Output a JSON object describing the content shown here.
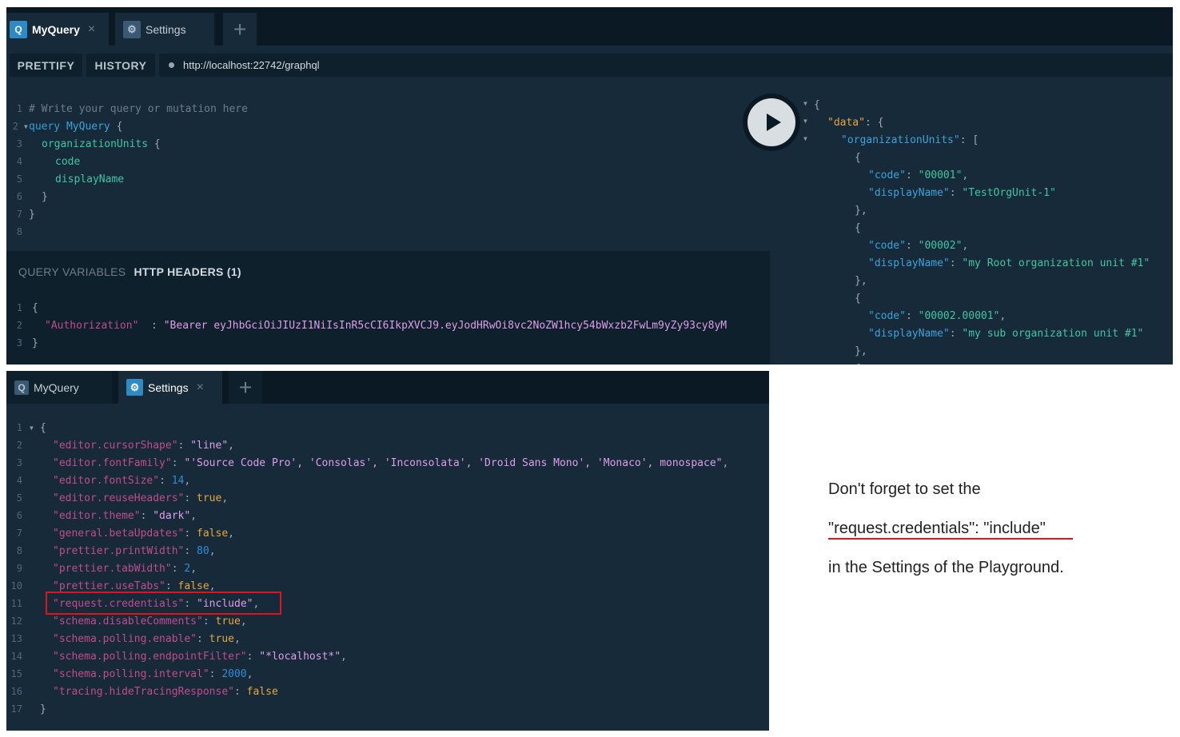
{
  "colors": {
    "accent": "#2d8ac4",
    "highlight_red": "#e0141c",
    "panel_bg": "#172a3a",
    "tabbar_bg": "#0b1924"
  },
  "top_panel": {
    "tabs": [
      {
        "icon": "Q",
        "label": "MyQuery",
        "close": "×"
      },
      {
        "icon": "⚙",
        "label": "Settings"
      }
    ],
    "add_tab": "+",
    "toolbar": {
      "prettify": "PRETTIFY",
      "history": "HISTORY",
      "url": "http://localhost:22742/graphql"
    },
    "query_lines": [
      {
        "n": "1",
        "text": "# Write your query or mutation here"
      },
      {
        "n": "2",
        "kw": "query",
        "name": "MyQuery",
        "brace": " {"
      },
      {
        "n": "3",
        "field": "organizationUnits",
        "brace": " {"
      },
      {
        "n": "4",
        "field": "code"
      },
      {
        "n": "5",
        "field": "displayName"
      },
      {
        "n": "6",
        "brace": "}"
      },
      {
        "n": "7",
        "brace": "}"
      },
      {
        "n": "8"
      }
    ],
    "vars_tabs": {
      "query_variables": "QUERY VARIABLES",
      "http_headers": "HTTP HEADERS (1)"
    },
    "headers_lines": [
      {
        "n": "1",
        "text": "{"
      },
      {
        "n": "2",
        "key": "\"Authorization\"",
        "sep": "  : ",
        "value": "\"Bearer eyJhbGciOiJIUzI1NiIsInR5cCI6IkpXVCJ9.eyJodHRwOi8vc2NoZW1hcy54bWxzb2FwLm9yZy93cy8yM"
      },
      {
        "n": "3",
        "text": "}"
      }
    ],
    "result_lines": [
      {
        "indent": 0,
        "text": "{"
      },
      {
        "indent": 1,
        "key": "\"data\"",
        "rest": ": {"
      },
      {
        "indent": 2,
        "key": "\"organizationUnits\"",
        "rest": ": ["
      },
      {
        "indent": 3,
        "text": "{"
      },
      {
        "indent": 4,
        "key": "\"code\"",
        "sep": ": ",
        "value": "\"00001\"",
        "end": ","
      },
      {
        "indent": 4,
        "key": "\"displayName\"",
        "sep": ": ",
        "value": "\"TestOrgUnit-1\""
      },
      {
        "indent": 3,
        "text": "},"
      },
      {
        "indent": 3,
        "text": "{"
      },
      {
        "indent": 4,
        "key": "\"code\"",
        "sep": ": ",
        "value": "\"00002\"",
        "end": ","
      },
      {
        "indent": 4,
        "key": "\"displayName\"",
        "sep": ": ",
        "value": "\"my Root organization unit #1\""
      },
      {
        "indent": 3,
        "text": "},"
      },
      {
        "indent": 3,
        "text": "{"
      },
      {
        "indent": 4,
        "key": "\"code\"",
        "sep": ": ",
        "value": "\"00002.00001\"",
        "end": ","
      },
      {
        "indent": 4,
        "key": "\"displayName\"",
        "sep": ": ",
        "value": "\"my sub organization unit #1\""
      },
      {
        "indent": 3,
        "text": "},"
      },
      {
        "indent": 3,
        "text": "{"
      }
    ]
  },
  "bottom_panel": {
    "tabs": [
      {
        "icon": "Q",
        "label": "MyQuery"
      },
      {
        "icon": "⚙",
        "label": "Settings",
        "close": "×"
      }
    ],
    "add_tab": "+",
    "settings_lines": [
      {
        "n": "1",
        "text": "{"
      },
      {
        "n": "2",
        "key": "\"editor.cursorShape\"",
        "value": "\"line\"",
        "type": "str",
        "end": ","
      },
      {
        "n": "3",
        "key": "\"editor.fontFamily\"",
        "value": "\"'Source Code Pro', 'Consolas', 'Inconsolata', 'Droid Sans Mono', 'Monaco', monospace\"",
        "type": "str",
        "end": ","
      },
      {
        "n": "4",
        "key": "\"editor.fontSize\"",
        "value": "14",
        "type": "num",
        "end": ","
      },
      {
        "n": "5",
        "key": "\"editor.reuseHeaders\"",
        "value": "true",
        "type": "bool",
        "end": ","
      },
      {
        "n": "6",
        "key": "\"editor.theme\"",
        "value": "\"dark\"",
        "type": "str",
        "end": ","
      },
      {
        "n": "7",
        "key": "\"general.betaUpdates\"",
        "value": "false",
        "type": "bool",
        "end": ","
      },
      {
        "n": "8",
        "key": "\"prettier.printWidth\"",
        "value": "80",
        "type": "num",
        "end": ","
      },
      {
        "n": "9",
        "key": "\"prettier.tabWidth\"",
        "value": "2",
        "type": "num",
        "end": ","
      },
      {
        "n": "10",
        "key": "\"prettier.useTabs\"",
        "value": "false",
        "type": "bool",
        "end": ","
      },
      {
        "n": "11",
        "key": "\"request.credentials\"",
        "value": "\"include\"",
        "type": "str",
        "end": ","
      },
      {
        "n": "12",
        "key": "\"schema.disableComments\"",
        "value": "true",
        "type": "bool",
        "end": ","
      },
      {
        "n": "13",
        "key": "\"schema.polling.enable\"",
        "value": "true",
        "type": "bool",
        "end": ","
      },
      {
        "n": "14",
        "key": "\"schema.polling.endpointFilter\"",
        "value": "\"*localhost*\"",
        "type": "str",
        "end": ","
      },
      {
        "n": "15",
        "key": "\"schema.polling.interval\"",
        "value": "2000",
        "type": "num",
        "end": ","
      },
      {
        "n": "16",
        "key": "\"tracing.hideTracingResponse\"",
        "value": "false",
        "type": "bool",
        "end": ""
      },
      {
        "n": "17",
        "text": "}"
      }
    ]
  },
  "note": {
    "line1": "Don't forget to set the",
    "line2": "\"request.credentials\": \"include\"",
    "line3": "in the Settings of the Playground."
  }
}
